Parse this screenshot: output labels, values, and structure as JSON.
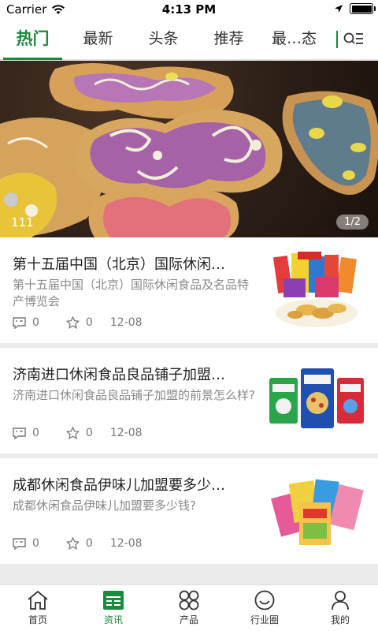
{
  "status_bar": {
    "carrier": "Carrier",
    "time": "4:13 PM"
  },
  "tabs": [
    {
      "label": "热门",
      "active": true
    },
    {
      "label": "最新",
      "active": false
    },
    {
      "label": "头条",
      "active": false
    },
    {
      "label": "推荐",
      "active": false
    },
    {
      "label": "最…态",
      "active": false
    }
  ],
  "banner": {
    "caption": "111",
    "page": "1/2"
  },
  "news": [
    {
      "title": "第十五届中国（北京）国际休闲…",
      "desc": "第十五届中国（北京）国际休闲食品及名品特产博览会",
      "comments": "0",
      "stars": "0",
      "date": "12-08"
    },
    {
      "title": "济南进口休闲食品良品铺子加盟…",
      "desc": "济南进口休闲食品良品铺子加盟的前景怎么样?",
      "comments": "0",
      "stars": "0",
      "date": "12-08"
    },
    {
      "title": "成都休闲食品伊味儿加盟要多少…",
      "desc": "成都休闲食品伊味儿加盟要多少钱?",
      "comments": "0",
      "stars": "0",
      "date": "12-08"
    }
  ],
  "bottom_nav": [
    {
      "label": "首页",
      "icon": "home-icon",
      "active": false
    },
    {
      "label": "资讯",
      "icon": "news-icon",
      "active": true
    },
    {
      "label": "产品",
      "icon": "grid-icon",
      "active": false
    },
    {
      "label": "行业圈",
      "icon": "smile-icon",
      "active": false
    },
    {
      "label": "我的",
      "icon": "user-icon",
      "active": false
    }
  ],
  "colors": {
    "accent": "#1e8a3c",
    "text": "#222222",
    "muted": "#8a8a8a",
    "background": "#ececec"
  }
}
